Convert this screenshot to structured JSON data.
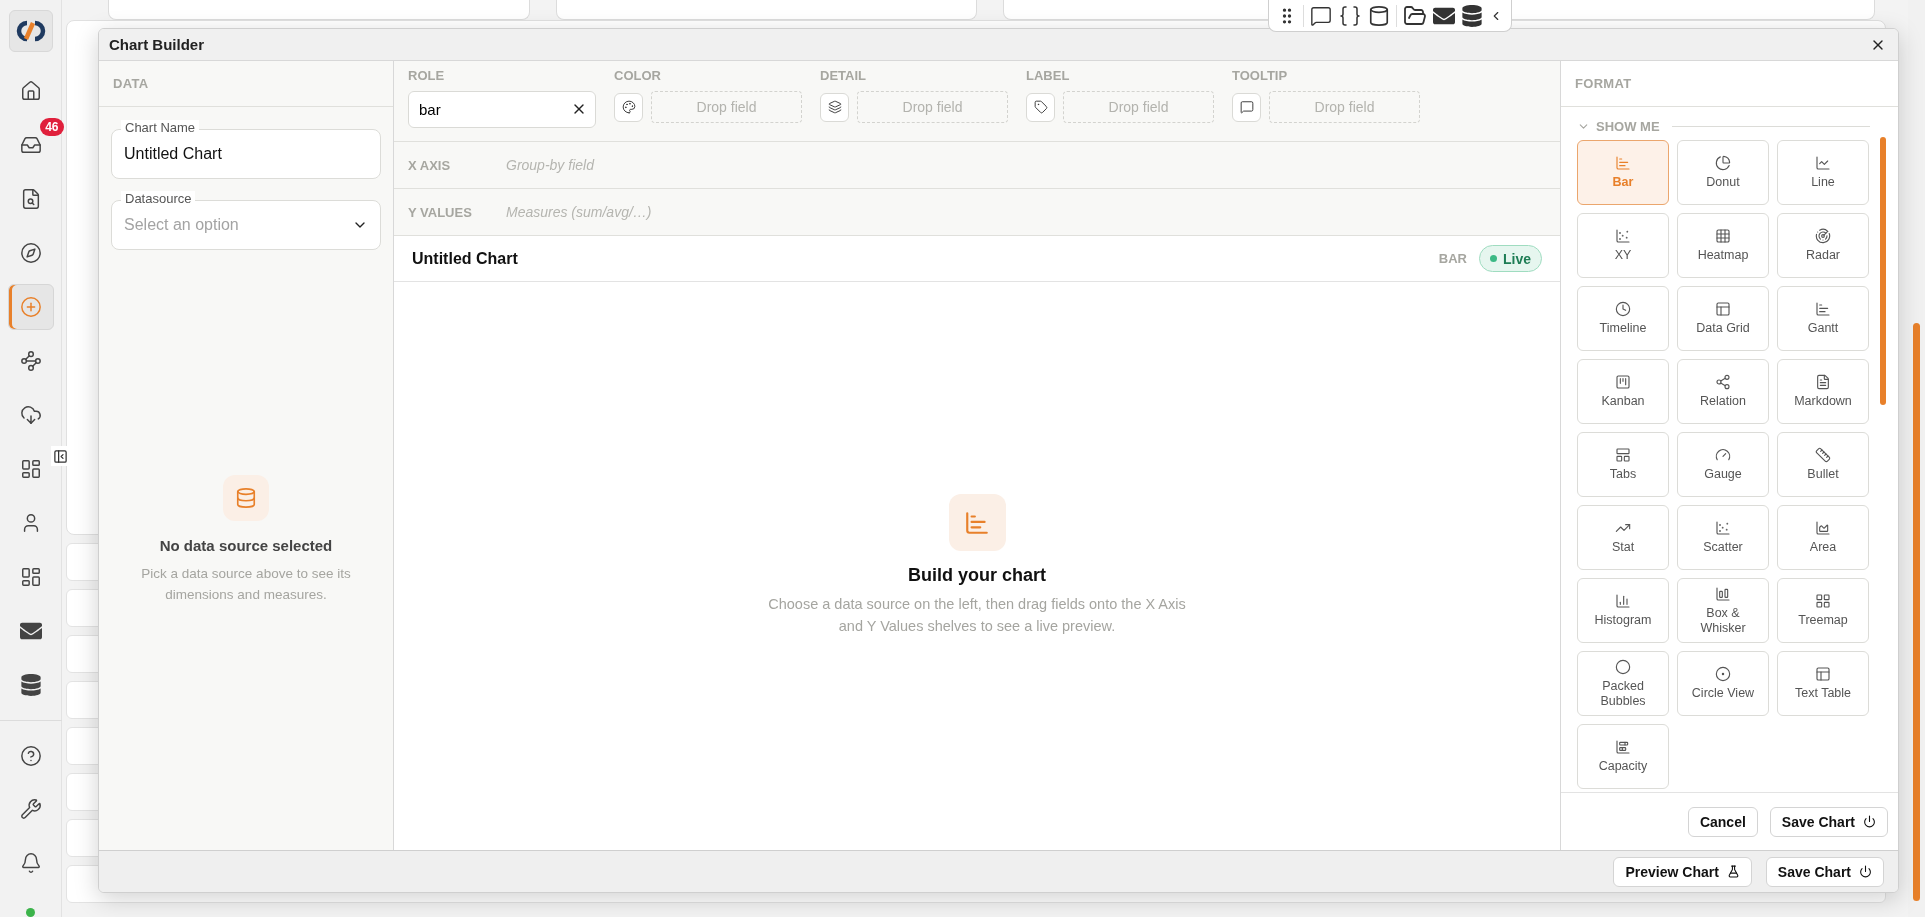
{
  "sidebar": {
    "items": [
      {
        "selected": false
      },
      {
        "selected": false,
        "badge": "46"
      },
      {
        "selected": false
      },
      {
        "selected": false
      },
      {
        "selected": true
      },
      {
        "selected": false
      },
      {
        "selected": false
      },
      {
        "selected": false
      },
      {
        "selected": false
      },
      {
        "selected": false
      },
      {
        "selected": false
      },
      {
        "selected": false
      }
    ],
    "bottom_items": [
      {
        "selected": false
      },
      {
        "selected": false
      },
      {
        "selected": false
      }
    ]
  },
  "dialog": {
    "title": "Chart Builder"
  },
  "data_panel": {
    "heading": "DATA",
    "chart_name": {
      "label": "Chart Name",
      "value": "Untitled Chart"
    },
    "datasource": {
      "label": "Datasource",
      "placeholder": "Select an option"
    },
    "empty_title": "No data source selected",
    "empty_text": "Pick a data source above to see its dimensions and measures."
  },
  "shelves": {
    "role": {
      "label": "ROLE",
      "value": "bar"
    },
    "marks": [
      {
        "label": "COLOR",
        "placeholder": "Drop field"
      },
      {
        "label": "DETAIL",
        "placeholder": "Drop field"
      },
      {
        "label": "LABEL",
        "placeholder": "Drop field"
      },
      {
        "label": "TOOLTIP",
        "placeholder": "Drop field"
      }
    ],
    "rows": [
      {
        "label": "X AXIS",
        "placeholder": "Group-by field"
      },
      {
        "label": "Y VALUES",
        "placeholder": "Measures (sum/avg/…)"
      }
    ]
  },
  "preview": {
    "title": "Untitled Chart",
    "type": "BAR",
    "status": "Live",
    "empty_title": "Build your chart",
    "empty_text": "Choose a data source on the left, then drag fields onto the X Axis and Y Values shelves to see a live preview."
  },
  "format_panel": {
    "heading": "FORMAT",
    "section": {
      "title": "SHOW ME",
      "expanded": true
    },
    "chart_types": [
      {
        "label": "Bar",
        "selected": true
      },
      {
        "label": "Donut",
        "selected": false
      },
      {
        "label": "Line",
        "selected": false
      },
      {
        "label": "XY",
        "selected": false
      },
      {
        "label": "Heatmap",
        "selected": false
      },
      {
        "label": "Radar",
        "selected": false
      },
      {
        "label": "Timeline",
        "selected": false
      },
      {
        "label": "Data Grid",
        "selected": false
      },
      {
        "label": "Gantt",
        "selected": false
      },
      {
        "label": "Kanban",
        "selected": false
      },
      {
        "label": "Relation",
        "selected": false
      },
      {
        "label": "Markdown",
        "selected": false
      },
      {
        "label": "Tabs",
        "selected": false
      },
      {
        "label": "Gauge",
        "selected": false
      },
      {
        "label": "Bullet",
        "selected": false
      },
      {
        "label": "Stat",
        "selected": false
      },
      {
        "label": "Scatter",
        "selected": false
      },
      {
        "label": "Area",
        "selected": false
      },
      {
        "label": "Histogram",
        "selected": false
      },
      {
        "label": "Box & Whisker",
        "selected": false
      },
      {
        "label": "Treemap",
        "selected": false
      },
      {
        "label": "Packed Bubbles",
        "selected": false
      },
      {
        "label": "Circle View",
        "selected": false
      },
      {
        "label": "Text Table",
        "selected": false
      },
      {
        "label": "Capacity",
        "selected": false
      }
    ],
    "buttons": [
      "Cancel",
      "Save Chart"
    ]
  },
  "footer": {
    "buttons": [
      "Preview Chart",
      "Save Chart"
    ]
  }
}
